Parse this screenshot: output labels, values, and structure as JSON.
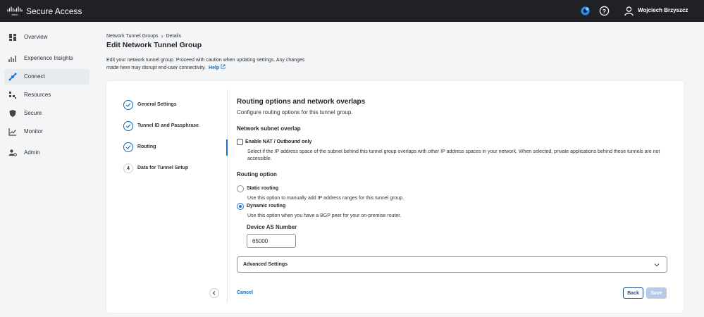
{
  "app": {
    "title": "Secure Access",
    "user_name": "Wojciech Brzyszcz"
  },
  "colors": {
    "topbar": "#1f2124",
    "accent": "#1e6fd9",
    "link": "#0d6bb8",
    "save_disabled": "#b6cbe6"
  },
  "sidebar": {
    "items": [
      {
        "label": "Overview",
        "icon": "dashboard-icon"
      },
      {
        "label": "Experience Insights",
        "icon": "insights-icon"
      },
      {
        "label": "Connect",
        "icon": "connect-icon",
        "active": true
      },
      {
        "label": "Resources",
        "icon": "resources-icon"
      },
      {
        "label": "Secure",
        "icon": "shield-icon"
      },
      {
        "label": "Monitor",
        "icon": "chart-icon"
      },
      {
        "label": "Admin",
        "icon": "admin-icon"
      }
    ]
  },
  "breadcrumb": {
    "parent": "Network Tunnel Groups",
    "current": "Details"
  },
  "page": {
    "title": "Edit Network Tunnel Group",
    "description": "Edit your network tunnel group. Proceed with caution when updating settings. Any changes made here may disrupt end-user connectivity.",
    "help_label": "Help"
  },
  "steps": [
    {
      "label": "General Settings",
      "state": "complete"
    },
    {
      "label": "Tunnel ID and Passphrase",
      "state": "complete"
    },
    {
      "label": "Routing",
      "state": "current"
    },
    {
      "label": "Data for Tunnel Setup",
      "state": "pending",
      "number": "4"
    }
  ],
  "form": {
    "section_title": "Routing options and network overlaps",
    "section_subtitle": "Configure routing options for this tunnel group.",
    "overlap_heading": "Network subnet overlap",
    "nat_label": "Enable NAT / Outbound only",
    "nat_checked": false,
    "nat_help": "Select if the IP address space of the subnet behind this tunnel group overlaps with other IP address spaces in your network. When selected, private applications behind these tunnels are not accessible.",
    "routing_heading": "Routing option",
    "static_label": "Static routing",
    "static_help": "Use this option to manually add IP address ranges for this tunnel group.",
    "dynamic_label": "Dynamic routing",
    "dynamic_help": "Use this option when you have a BGP peer for your on-premise router.",
    "selected_routing": "Dynamic routing",
    "as_label": "Device AS Number",
    "as_value": "65000",
    "advanced_label": "Advanced Settings"
  },
  "actions": {
    "cancel": "Cancel",
    "back": "Back",
    "save": "Save"
  }
}
